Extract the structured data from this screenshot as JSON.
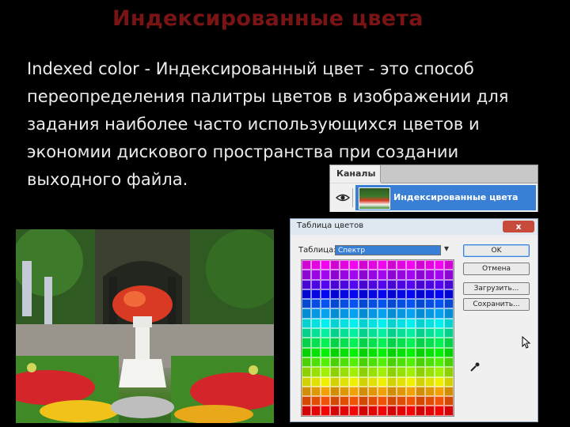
{
  "slide": {
    "title": "Индексированные цвета",
    "body_lines": [
      "Indexed color - Индексированный цвет - это способ",
      "переопределения палитры цветов в изображении для",
      "задания наиболее часто использующихся цветов и",
      "экономии дискового пространства при создании",
      "выходного файла."
    ]
  },
  "channels_panel": {
    "tab_label": "Каналы",
    "channel_label": "Индексированные цвета",
    "eye_icon": "eye-icon"
  },
  "color_table_dialog": {
    "title": "Таблица цветов",
    "close_label": "x",
    "table_label": "Таблица:",
    "table_value": "Спектр",
    "buttons": {
      "ok": "OK",
      "cancel": "Отмена",
      "load": "Загрузить...",
      "save": "Сохранить..."
    }
  },
  "colors": {
    "title": "#7a1414",
    "body_text": "#ececec",
    "selection": "#3a7fd6"
  }
}
